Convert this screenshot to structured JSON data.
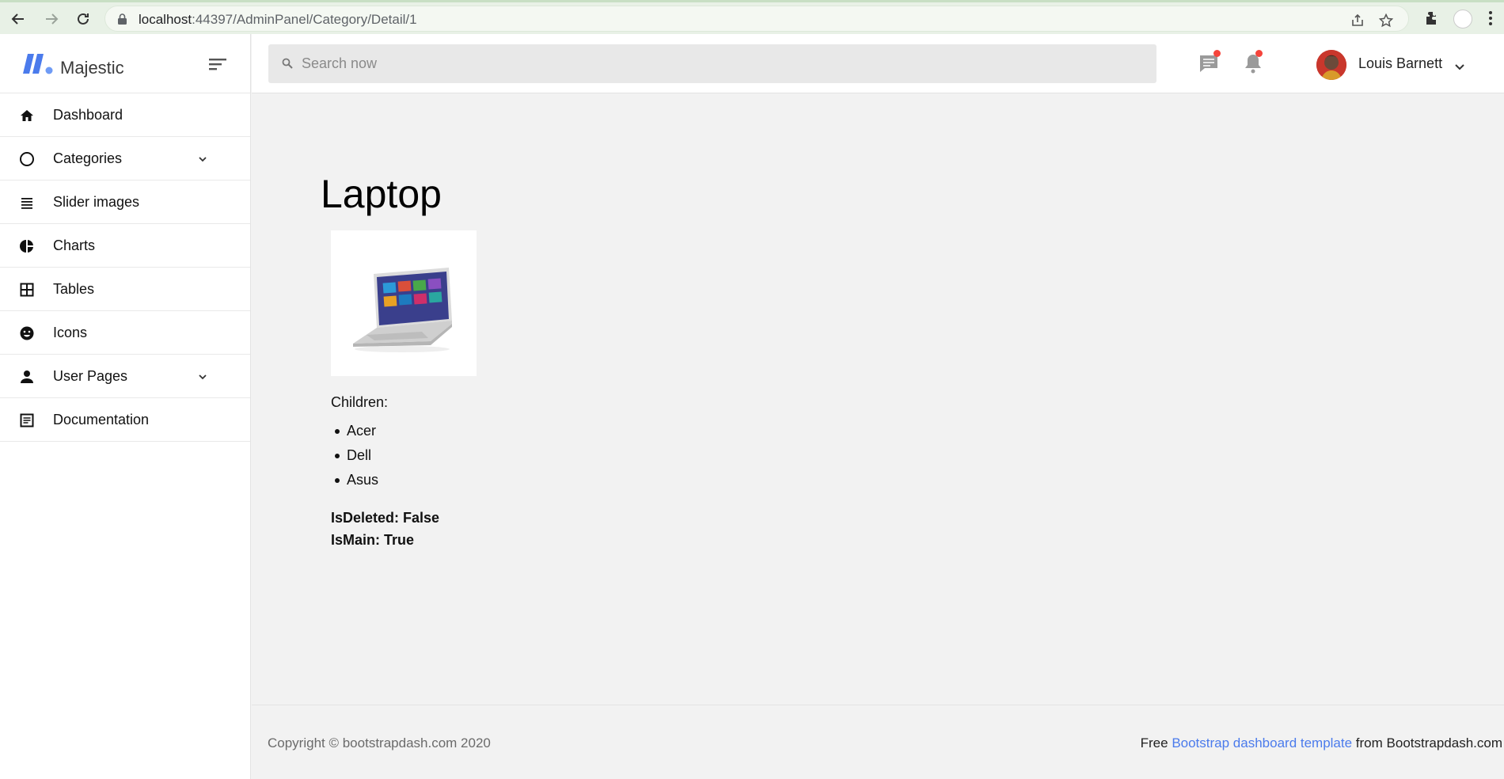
{
  "browser": {
    "url_host": "localhost",
    "url_rest": ":44397/AdminPanel/Category/Detail/1"
  },
  "sidebar": {
    "brand": "Majestic",
    "items": [
      {
        "label": "Dashboard",
        "icon": "home-icon",
        "has_arrow": false
      },
      {
        "label": "Categories",
        "icon": "circle-icon",
        "has_arrow": true
      },
      {
        "label": "Slider images",
        "icon": "list-icon",
        "has_arrow": false
      },
      {
        "label": "Charts",
        "icon": "pie-chart-icon",
        "has_arrow": false
      },
      {
        "label": "Tables",
        "icon": "grid-icon",
        "has_arrow": false
      },
      {
        "label": "Icons",
        "icon": "smiley-icon",
        "has_arrow": false
      },
      {
        "label": "User Pages",
        "icon": "user-icon",
        "has_arrow": true
      },
      {
        "label": "Documentation",
        "icon": "document-icon",
        "has_arrow": false
      }
    ]
  },
  "topbar": {
    "search_placeholder": "Search now",
    "username": "Louis Barnett"
  },
  "main": {
    "title": "Laptop",
    "children_label": "Children:",
    "children": [
      "Acer",
      "Dell",
      "Asus"
    ],
    "is_deleted": "IsDeleted: False",
    "is_main": "IsMain: True"
  },
  "footer": {
    "copyright": "Copyright © bootstrapdash.com 2020",
    "credit_prefix": "Free ",
    "credit_link": "Bootstrap dashboard template",
    "credit_suffix": " from Bootstrapdash.com"
  },
  "colors": {
    "accent": "#4b7bec",
    "badge": "#f5443b",
    "content_bg": "#f2f2f2"
  }
}
